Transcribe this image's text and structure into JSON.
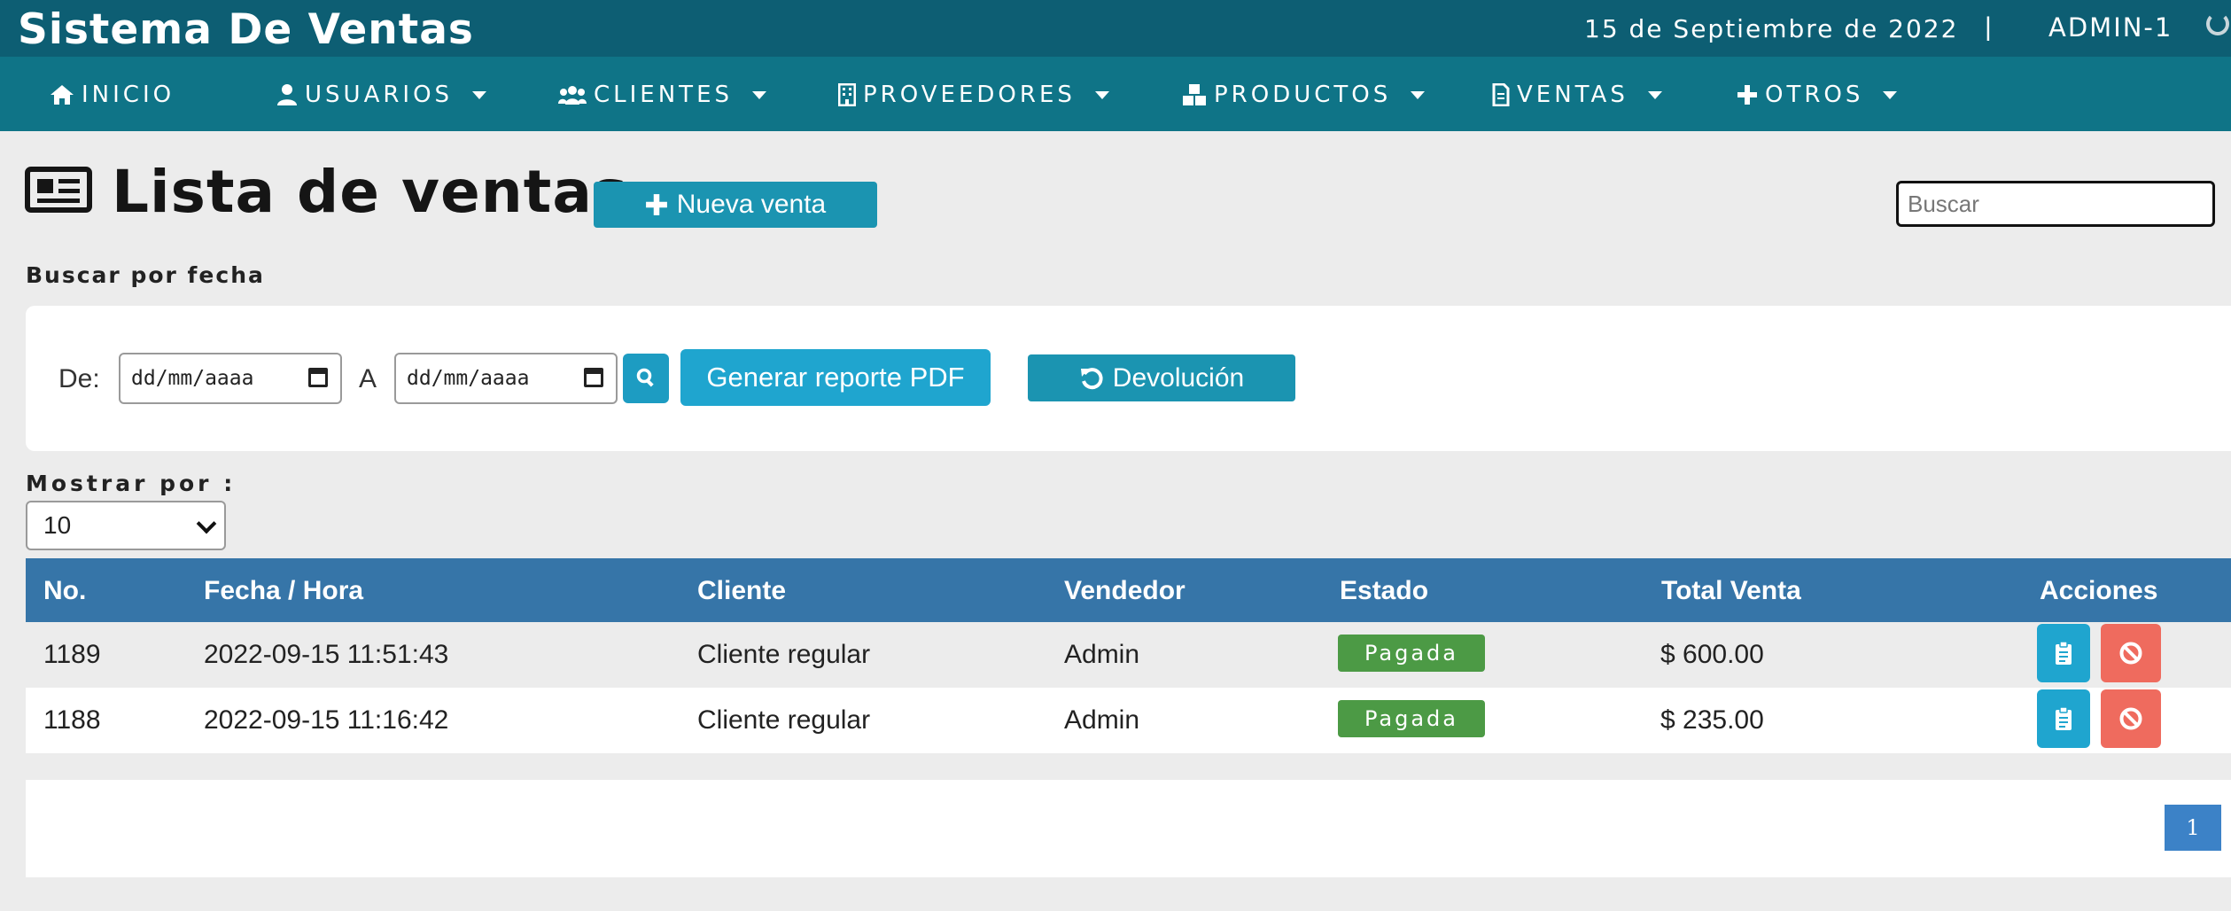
{
  "header": {
    "app_title": "Sistema De Ventas",
    "date": "15 de Septiembre de 2022",
    "separator": "|",
    "user": "ADMIN-1",
    "power_icon": "power-icon"
  },
  "nav": {
    "items": [
      {
        "label": "INICIO",
        "icon": "home-icon"
      },
      {
        "label": "USUARIOS",
        "icon": "user-icon"
      },
      {
        "label": "CLIENTES",
        "icon": "users-icon"
      },
      {
        "label": "PROVEEDORES",
        "icon": "building-icon"
      },
      {
        "label": "PRODUCTOS",
        "icon": "cubes-icon"
      },
      {
        "label": "VENTAS",
        "icon": "file-icon"
      },
      {
        "label": "OTROS",
        "icon": "plus-icon"
      }
    ]
  },
  "page": {
    "title": "Lista de ventas",
    "new_sale_label": "Nueva venta",
    "search_placeholder": "Buscar"
  },
  "filter": {
    "section_label": "Buscar por fecha",
    "from_label": "De:",
    "from_value": "dd/mm/aaaa",
    "to_label": "A",
    "to_value": "dd/mm/aaaa",
    "pdf_label": "Generar reporte PDF",
    "return_label": "Devolución"
  },
  "per_page": {
    "label": "Mostrar por :",
    "value": "10"
  },
  "table": {
    "headers": [
      "No.",
      "Fecha / Hora",
      "Cliente",
      "Vendedor",
      "Estado",
      "Total Venta",
      "Acciones"
    ],
    "rows": [
      {
        "no": "1189",
        "datetime": "2022-09-15 11:51:43",
        "client": "Cliente regular",
        "seller": "Admin",
        "status": "Pagada",
        "total": "$ 600.00"
      },
      {
        "no": "1188",
        "datetime": "2022-09-15 11:16:42",
        "client": "Cliente regular",
        "seller": "Admin",
        "status": "Pagada",
        "total": "$ 235.00"
      }
    ]
  },
  "pagination": {
    "current": "1"
  },
  "colors": {
    "topbar": "#0d5e73",
    "navbar": "#0f7487",
    "table_header": "#3675a8",
    "badge_paid": "#4c9a45",
    "action_view": "#1fa5cf",
    "action_cancel": "#ef6b5e"
  }
}
